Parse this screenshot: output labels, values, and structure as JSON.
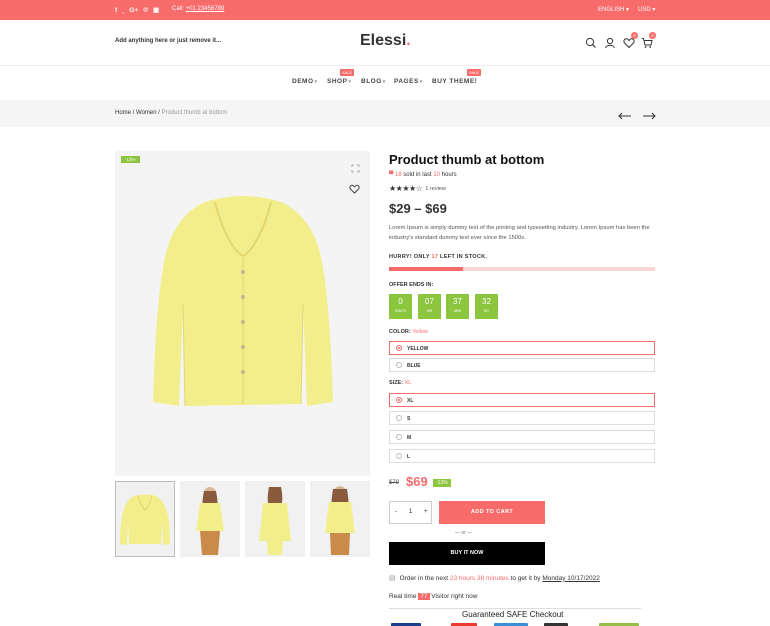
{
  "topbar": {
    "social_icons": [
      "facebook-icon",
      "twitter-icon",
      "google-plus-icon",
      "pinterest-icon",
      "instagram-icon"
    ],
    "social_glyphs": [
      "f",
      "ˬ",
      "G+",
      "℗",
      "▣"
    ],
    "call_label": "Call:",
    "phone": "+01 23456789",
    "language": "ENGLISH",
    "currency": "USD"
  },
  "header": {
    "tagline": "Add anything here or just remove it...",
    "logo_text": "Elessi",
    "logo_dot": ".",
    "wishlist_count": "0",
    "cart_count": "0"
  },
  "nav": {
    "items": [
      {
        "label": "DEMO"
      },
      {
        "label": "SHOP"
      },
      {
        "label": "BLOG"
      },
      {
        "label": "PAGES"
      },
      {
        "label": "BUY THEME!"
      }
    ],
    "sale_badge": "SALE"
  },
  "breadcrumb": {
    "home": "Home",
    "sep": " / ",
    "category": "Women",
    "current": "Product thumb at bottom"
  },
  "gallery": {
    "discount_badge": "-13%"
  },
  "product": {
    "title": "Product thumb at bottom",
    "sold_count": "18",
    "sold_mid": " sold in last ",
    "sold_hours": "10",
    "sold_end": " hours",
    "rating": 4,
    "stars": "★★★★☆",
    "reviews": "1 review",
    "price_range": "$29 – $69",
    "description": "Lorem Ipsum is simply dummy text of the printing and typesetting industry. Lorem Ipsum has been the industry's standard dummy text ever since the 1500s.",
    "hurry_pre": "HURRY! ONLY ",
    "hurry_count": "17",
    "hurry_post": " LEFT IN STOCK.",
    "stock_fraction": 0.28,
    "offer_label": "OFFER ENDS IN:",
    "countdown": [
      {
        "n": "0",
        "l": "DAYS"
      },
      {
        "n": "07",
        "l": "HR"
      },
      {
        "n": "37",
        "l": "MIN"
      },
      {
        "n": "32",
        "l": "SC"
      }
    ],
    "color_label": "COLOR:",
    "color_value": "Yellow",
    "colors": [
      "YELLOW",
      "BLUE"
    ],
    "size_label": "SIZE:",
    "size_value": "XL",
    "sizes": [
      "XL",
      "S",
      "M",
      "L"
    ],
    "old_price": "$79",
    "new_price": "$69",
    "save_badge": "-13%",
    "qty_minus": "-",
    "qty": "1",
    "qty_plus": "+",
    "add_to_cart": "ADD TO CART",
    "or": "— or —",
    "buy_now": "BUY IT NOW",
    "order_pre": "Order in the next ",
    "order_time": "23 hours 38 minutes",
    "order_mid": " to get it by ",
    "order_date": "Monday 10/17/2022",
    "realtime_pre": "Real time ",
    "visitors": "77",
    "realtime_post": " Visitor right now",
    "safe_checkout": "Guaranteed SAFE Checkout"
  },
  "colors": {
    "accent": "#f76b6a",
    "green": "#8cc63f",
    "product_yellow": "#f3ee8c"
  }
}
